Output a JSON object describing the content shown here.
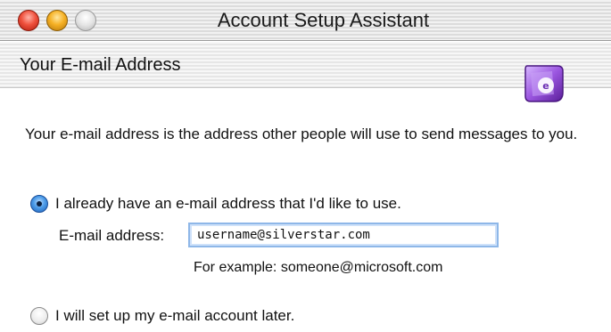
{
  "window": {
    "title": "Account Setup Assistant",
    "controls": [
      "close",
      "minimize",
      "zoom"
    ]
  },
  "header": {
    "title": "Your E-mail Address",
    "logo_icon": "entourage-logo-icon"
  },
  "body": {
    "description": "Your e-mail address is the address other people will use to send messages to you.",
    "options": [
      {
        "label": "I already have an e-mail address that I'd like to use.",
        "selected": true
      },
      {
        "label": "I will set up my e-mail account later.",
        "selected": false
      }
    ],
    "email_field": {
      "label": "E-mail address:",
      "value": "username@silverstar.com"
    },
    "example_text": "For example: someone@microsoft.com"
  },
  "colors": {
    "close": "#f0523e",
    "minimize": "#f6b125",
    "zoom": "#e4e4e4",
    "radio_selected": "#4d9ce8",
    "field_focus": "#8eb7e8"
  }
}
